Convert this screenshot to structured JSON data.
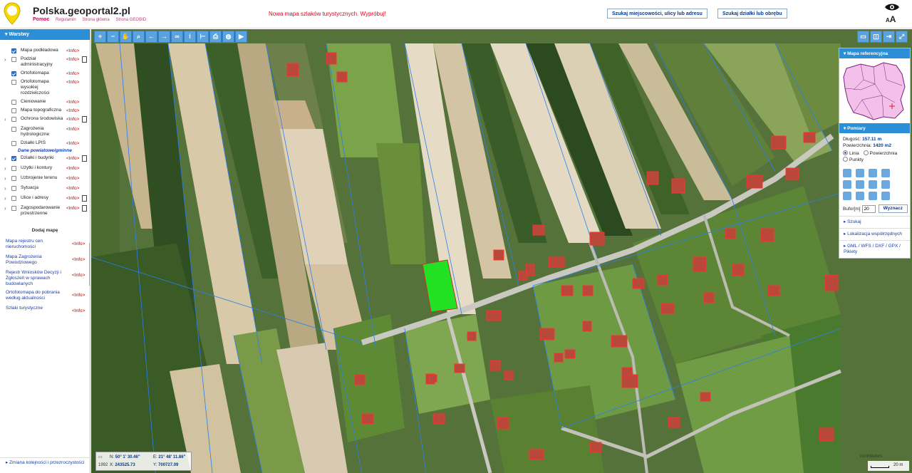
{
  "header": {
    "logo_text": "GEOBID",
    "title": "Polska.geoportal2.pl",
    "nav": [
      "Pomoc",
      "Regulamin",
      "Strona główna",
      "Strona GEOBID"
    ],
    "promo": "Nowa mapa szlaków turystycznych. Wypróbuj!",
    "search_place_btn": "Szukaj miejscowości, ulicy lub adresu",
    "search_parcel_btn": "Szukaj działki lub obrębu",
    "font_toggle_small": "A",
    "font_toggle_big": "A"
  },
  "sidebar": {
    "title": "Warstwy",
    "layers": [
      {
        "label": "Mapa podkładowa",
        "checked": true,
        "arrow": false,
        "info": "<Info>",
        "doc": false
      },
      {
        "label": "Podział administracyjny",
        "checked": false,
        "arrow": true,
        "info": "<Info>",
        "doc": true
      },
      {
        "label": "Ortofotomapa",
        "checked": true,
        "arrow": false,
        "info": "<Info>",
        "doc": false
      },
      {
        "label": "Ortofotomapa wysokiej rozdzielczości",
        "checked": false,
        "arrow": false,
        "info": "<Info>",
        "doc": false
      },
      {
        "label": "Cieniowanie",
        "checked": false,
        "arrow": false,
        "info": "<Info>",
        "doc": false
      },
      {
        "label": "Mapa topograficzna",
        "checked": false,
        "arrow": false,
        "info": "<Info>",
        "doc": false
      },
      {
        "label": "Ochrona środowiska",
        "checked": false,
        "arrow": true,
        "info": "<Info>",
        "doc": true
      },
      {
        "label": "Zagrożenia hydrologiczne",
        "checked": false,
        "arrow": false,
        "info": "<Info>",
        "doc": false
      },
      {
        "label": "Działki LPIS",
        "checked": false,
        "arrow": false,
        "info": "<Info>",
        "doc": false
      }
    ],
    "section_label": "Dane powiatowe/gminne",
    "county_layers": [
      {
        "label": "Działki i budynki",
        "checked": true,
        "arrow": true,
        "info": "<Info>",
        "doc": true
      },
      {
        "label": "Użytki i kontury",
        "checked": false,
        "arrow": true,
        "info": "<Info>",
        "doc": false
      },
      {
        "label": "Uzbrojenie terenu",
        "checked": false,
        "arrow": true,
        "info": "<Info>",
        "doc": false
      },
      {
        "label": "Sytuacja",
        "checked": false,
        "arrow": true,
        "info": "<Info>",
        "doc": false
      },
      {
        "label": "Ulice i adresy",
        "checked": false,
        "arrow": true,
        "info": "<Info>",
        "doc": true
      },
      {
        "label": "Zagospodarowanie przestrzenne",
        "checked": false,
        "arrow": true,
        "info": "<Info>",
        "doc": true
      }
    ],
    "add_map_title": "Dodaj mapę",
    "add_maps": [
      {
        "label": "Mapa rejestru cen nieruchomości",
        "info": "<Info>"
      },
      {
        "label": "Mapa Zagrożenia Powodziowego",
        "info": "<Info>"
      },
      {
        "label": "Rejestr Wniosków Decyzji i Zgłoszeń w sprawach budowlanych",
        "info": "<Info>"
      },
      {
        "label": "Ortofotomapa do pobrania według aktualności",
        "info": "<Info>"
      },
      {
        "label": "Szlaki turystyczne",
        "info": "<Info>"
      }
    ],
    "footer": "Zmiana kolejności i przezroczystości"
  },
  "toolbar": {
    "tools": [
      "zoom-in-icon",
      "zoom-out-icon",
      "pan-hand-icon",
      "magnifier-icon",
      "back-arrow-icon",
      "forward-arrow-icon",
      "link-icon",
      "info-icon",
      "measure-icon",
      "print-icon",
      "globe-icon",
      "video-icon"
    ],
    "right_tools": [
      "layout-icon",
      "split-icon",
      "expand-icon",
      "fullscreen-icon"
    ]
  },
  "right_panel": {
    "ref_map_title": "Mapa referencyjna",
    "measure_title": "Pomiary",
    "length_label": "Długość:",
    "length_value": "157.11 m",
    "area_label": "Powierzchnia:",
    "area_value": "1420 m2",
    "opt_line": "Linia",
    "opt_area": "Powierzchnia",
    "opt_points": "Punkty",
    "buffer_label": "Bufor[m]",
    "buffer_value": "20",
    "compute_btn": "Wyznacz",
    "links": [
      "Szukaj",
      "Lokalizacja współrzędnych",
      "GML / WFS / DXF / GPX / Pikiety"
    ]
  },
  "coords": {
    "n_label": "N:",
    "n_value": "50° 1' 30.46\"",
    "e_label": "E:",
    "e_value": "21° 48' 11.86\"",
    "sys": "1992",
    "x_label": "X:",
    "x_value": "243525.73",
    "y_label": "Y:",
    "y_value": "700727.09"
  },
  "scale_label": "20 m",
  "attribution": "contributors",
  "colors": {
    "accent": "#2b8fd8",
    "info_red": "#c00000",
    "highlight": "#22e022"
  }
}
